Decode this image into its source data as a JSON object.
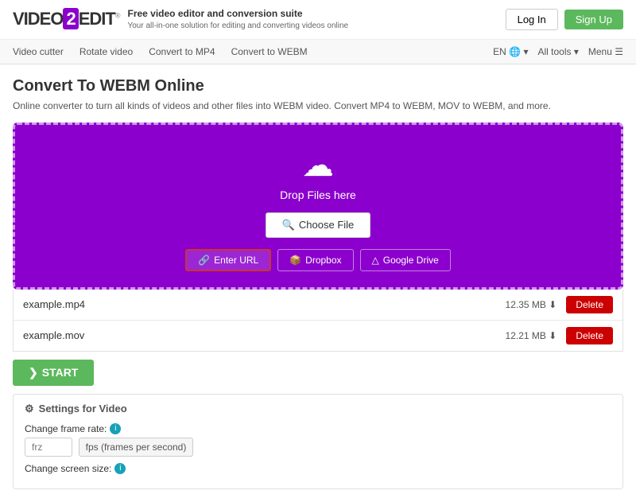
{
  "header": {
    "logo": "VIDEO",
    "logo_two": "2",
    "logo_edit": "EDIT",
    "tagline_main": "Free video editor and conversion suite",
    "tagline_sub": "Your all-in-one solution for editing and converting videos online",
    "login_label": "Log In",
    "signup_label": "Sign Up"
  },
  "nav": {
    "items": [
      {
        "label": "Video cutter"
      },
      {
        "label": "Rotate video"
      },
      {
        "label": "Convert to MP4"
      },
      {
        "label": "Convert to WEBM"
      }
    ],
    "lang": "EN",
    "all_tools": "All tools",
    "menu": "Menu"
  },
  "page": {
    "title": "Convert To WEBM Online",
    "description": "Online converter to turn all kinds of videos and other files into WEBM video. Convert MP4 to WEBM, MOV to WEBM, and more."
  },
  "upload": {
    "drop_text": "Drop Files here",
    "choose_file": "Choose File",
    "enter_url": "Enter URL",
    "dropbox": "Dropbox",
    "google_drive": "Google Drive"
  },
  "files": [
    {
      "name": "example.mp4",
      "size": "12.35 MB"
    },
    {
      "name": "example.mov",
      "size": "12.21 MB"
    }
  ],
  "delete_label": "Delete",
  "start_label": "START",
  "settings": {
    "title": "Settings for Video",
    "frame_rate_label": "Change frame rate:",
    "frame_rate_placeholder": "frz",
    "frame_rate_unit": "fps (frames per second)",
    "screen_size_label": "Change screen size:"
  }
}
